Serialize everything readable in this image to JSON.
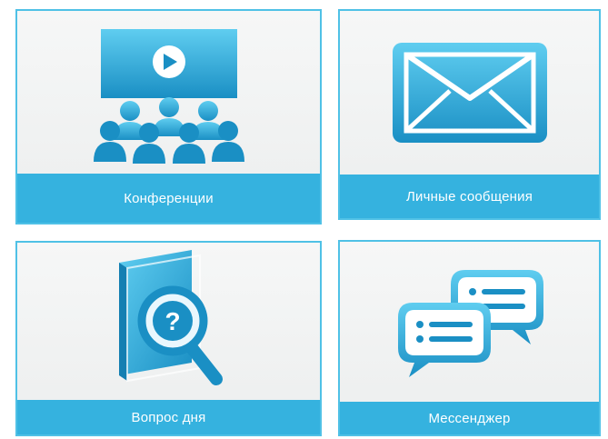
{
  "tiles": [
    {
      "label": "Конференции",
      "icon": "conference-icon"
    },
    {
      "label": "Личные сообщения",
      "icon": "envelope-icon"
    },
    {
      "label": "Вопрос дня",
      "icon": "question-book-icon"
    },
    {
      "label": "Мессенджер",
      "icon": "chat-bubbles-icon"
    }
  ],
  "colors": {
    "accent": "#35b2df",
    "border": "#4fc1e6",
    "icon_dark": "#1a8fc4",
    "icon_light": "#5fcdf0",
    "tile_bg": "#f2f3f3"
  }
}
